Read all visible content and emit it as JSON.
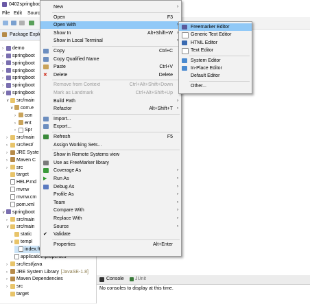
{
  "window": {
    "title": "0402springboot"
  },
  "menubar": [
    "File",
    "Edit",
    "Source"
  ],
  "explorer": {
    "title": "Package Explorer",
    "tree": [
      {
        "twisty": ">",
        "icon": "project",
        "label": "demo"
      },
      {
        "twisty": ">",
        "icon": "project",
        "label": "springboot"
      },
      {
        "twisty": ">",
        "icon": "project",
        "label": "springboot"
      },
      {
        "twisty": ">",
        "icon": "project",
        "label": "springboot"
      },
      {
        "twisty": ">",
        "icon": "project",
        "label": "springboot"
      },
      {
        "twisty": ">",
        "icon": "project",
        "label": "springboot"
      },
      {
        "twisty": "v",
        "icon": "project",
        "label": "springboot"
      },
      {
        "twisty": "v",
        "icon": "folder",
        "label": "src/main"
      },
      {
        "twisty": "v",
        "icon": "package",
        "label": "com.e"
      },
      {
        "twisty": ">",
        "icon": "package",
        "label": "con"
      },
      {
        "twisty": ">",
        "icon": "package",
        "label": "ent"
      },
      {
        "twisty": ">",
        "icon": "file",
        "label": "Spr"
      },
      {
        "twisty": ">",
        "icon": "folder",
        "label": "src/main"
      },
      {
        "twisty": ">",
        "icon": "folder",
        "label": "src/test/"
      },
      {
        "twisty": ">",
        "icon": "library",
        "label": "JRE Syste"
      },
      {
        "twisty": ">",
        "icon": "library",
        "label": "Maven C"
      },
      {
        "twisty": ">",
        "icon": "folder",
        "label": "src"
      },
      {
        "twisty": "",
        "icon": "folder",
        "label": "target"
      },
      {
        "twisty": "",
        "icon": "file",
        "label": "HELP.md"
      },
      {
        "twisty": "",
        "icon": "file",
        "label": "mvnw"
      },
      {
        "twisty": "",
        "icon": "file",
        "label": "mvnw.cm"
      },
      {
        "twisty": "",
        "icon": "file",
        "label": "pom.xml"
      },
      {
        "twisty": "v",
        "icon": "project",
        "label": "springboot"
      },
      {
        "twisty": ">",
        "icon": "folder",
        "label": "src/main"
      },
      {
        "twisty": "v",
        "icon": "folder",
        "label": "src/main"
      },
      {
        "twisty": "",
        "icon": "folder",
        "label": "static"
      },
      {
        "twisty": "v",
        "icon": "folder",
        "label": "templ"
      },
      {
        "twisty": "",
        "icon": "file",
        "label": "index.ft",
        "selected": true
      },
      {
        "twisty": "",
        "icon": "file",
        "label": "application.properties"
      },
      {
        "twisty": ">",
        "icon": "folder",
        "label": "src/test/java"
      },
      {
        "twisty": ">",
        "icon": "library",
        "label": "JRE System Library",
        "suffix": "[JavaSE-1.8]"
      },
      {
        "twisty": ">",
        "icon": "library",
        "label": "Maven Dependencies"
      },
      {
        "twisty": ">",
        "icon": "folder",
        "label": "src"
      },
      {
        "twisty": "",
        "icon": "folder",
        "label": "target"
      }
    ]
  },
  "context_menu": {
    "items": [
      {
        "label": "New",
        "accel": "",
        "submenu": true
      },
      {
        "sep": true
      },
      {
        "label": "Open",
        "accel": "F3"
      },
      {
        "label": "Open With",
        "accel": "",
        "submenu": true,
        "highlighted": true
      },
      {
        "label": "Show In",
        "accel": "Alt+Shift+W",
        "submenu": true
      },
      {
        "label": "Show in Local Terminal",
        "accel": "",
        "submenu": true
      },
      {
        "sep": true
      },
      {
        "label": "Copy",
        "accel": "Ctrl+C",
        "icon": "copy-icon"
      },
      {
        "label": "Copy Qualified Name",
        "accel": "",
        "icon": "copy-icon"
      },
      {
        "label": "Paste",
        "accel": "Ctrl+V",
        "icon": "paste-icon"
      },
      {
        "label": "Delete",
        "accel": "Delete",
        "icon": "delete-icon"
      },
      {
        "sep": true
      },
      {
        "label": "Remove from Context",
        "accel": "Ctrl+Alt+Shift+Down",
        "disabled": true
      },
      {
        "label": "Mark as Landmark",
        "accel": "Ctrl+Alt+Shift+Up",
        "disabled": true
      },
      {
        "label": "Build Path",
        "accel": "",
        "submenu": true
      },
      {
        "label": "Refactor",
        "accel": "Alt+Shift+T",
        "submenu": true
      },
      {
        "sep": true
      },
      {
        "label": "Import...",
        "accel": "",
        "icon": "import-icon"
      },
      {
        "label": "Export...",
        "accel": "",
        "icon": "export-icon"
      },
      {
        "sep": true
      },
      {
        "label": "Refresh",
        "accel": "F5",
        "icon": "refresh-icon"
      },
      {
        "label": "Assign Working Sets...",
        "accel": ""
      },
      {
        "sep": true
      },
      {
        "label": "Show in Remote Systems view",
        "accel": ""
      },
      {
        "label": "Use as FreeMarker library",
        "accel": "",
        "icon": "gear-icon"
      },
      {
        "label": "Coverage As",
        "accel": "",
        "submenu": true,
        "icon": "coverage-icon"
      },
      {
        "label": "Run As",
        "accel": "",
        "submenu": true,
        "icon": "run-icon"
      },
      {
        "label": "Debug As",
        "accel": "",
        "submenu": true,
        "icon": "debug-icon"
      },
      {
        "label": "Profile As",
        "accel": "",
        "submenu": true
      },
      {
        "label": "Team",
        "accel": "",
        "submenu": true
      },
      {
        "label": "Compare With",
        "accel": "",
        "submenu": true
      },
      {
        "label": "Replace With",
        "accel": "",
        "submenu": true
      },
      {
        "label": "Source",
        "accel": "",
        "submenu": true
      },
      {
        "label": "Validate",
        "accel": "",
        "icon": "check-icon"
      },
      {
        "sep": true
      },
      {
        "label": "Properties",
        "accel": "Alt+Enter"
      }
    ]
  },
  "submenu": {
    "items": [
      {
        "label": "Freemarker Editor",
        "highlighted": true,
        "icon": "freemarker-icon"
      },
      {
        "label": "Generic Text Editor",
        "icon": "text-editor-icon"
      },
      {
        "label": "HTML Editor",
        "icon": "html-editor-icon"
      },
      {
        "label": "Text Editor",
        "icon": "text-editor-icon"
      },
      {
        "sep": true
      },
      {
        "label": "System Editor",
        "icon": "system-editor-icon"
      },
      {
        "label": "In-Place Editor",
        "icon": "inplace-editor-icon"
      },
      {
        "label": "Default Editor",
        "icon": ""
      },
      {
        "sep": true
      },
      {
        "label": "Other...",
        "icon": ""
      }
    ]
  },
  "console": {
    "tabs": [
      "Console",
      "JUnit"
    ],
    "message": "No consoles to display at this time."
  }
}
